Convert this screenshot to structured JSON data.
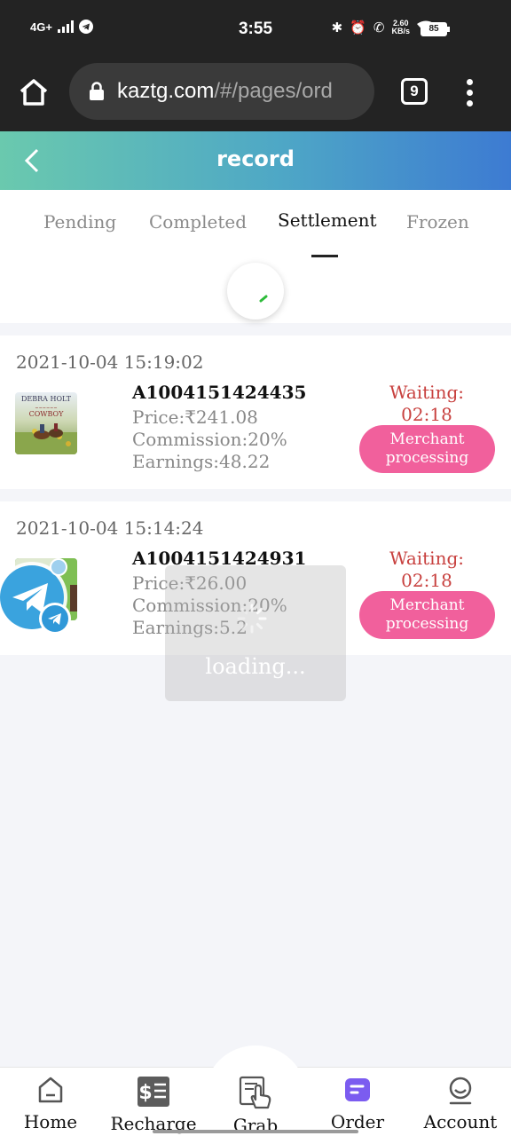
{
  "status_bar": {
    "network": "4G+",
    "time": "3:55",
    "speed_value": "2.60",
    "speed_unit": "KB/s",
    "battery": "85"
  },
  "browser": {
    "url_host": "kaztg.com",
    "url_path": "/#/pages/ord",
    "tab_count": "9"
  },
  "header": {
    "title": "record"
  },
  "tabs": [
    {
      "label": "Pending",
      "active": false
    },
    {
      "label": "Completed",
      "active": false
    },
    {
      "label": "Settlement",
      "active": true
    },
    {
      "label": "Frozen",
      "active": false
    }
  ],
  "orders": [
    {
      "date": "2021-10-04 15:19:02",
      "order_no": "A1004151424435",
      "price": "Price:₹241.08",
      "commission": "Commission:20%",
      "earnings": "Earnings:48.22",
      "waiting_label": "Waiting:",
      "waiting_time": "02:18",
      "status_line1": "Merchant",
      "status_line2": "processing",
      "thumb_text_1": "DEBRA HOLT",
      "thumb_text_2": "COWBOY"
    },
    {
      "date": "2021-10-04 15:14:24",
      "order_no": "A1004151424931",
      "price": "Price:₹26.00",
      "commission": "Commission:20%",
      "earnings": "Earnings:5.2",
      "waiting_label": "Waiting:",
      "waiting_time": "02:18",
      "status_line1": "Merchant",
      "status_line2": "processing"
    }
  ],
  "loading": {
    "label": "loading..."
  },
  "bottom_nav": [
    {
      "label": "Home",
      "icon": "home-icon"
    },
    {
      "label": "Recharge",
      "icon": "recharge-icon"
    },
    {
      "label": "Grab",
      "icon": "grab-icon"
    },
    {
      "label": "Order",
      "icon": "order-icon"
    },
    {
      "label": "Account",
      "icon": "account-icon"
    }
  ],
  "colors": {
    "accent_pink": "#f1609c",
    "waiting_red": "#c8413f",
    "header_start": "#6ac9ae",
    "header_end": "#3d7bd2",
    "order_icon_purple": "#7b5cf0"
  }
}
